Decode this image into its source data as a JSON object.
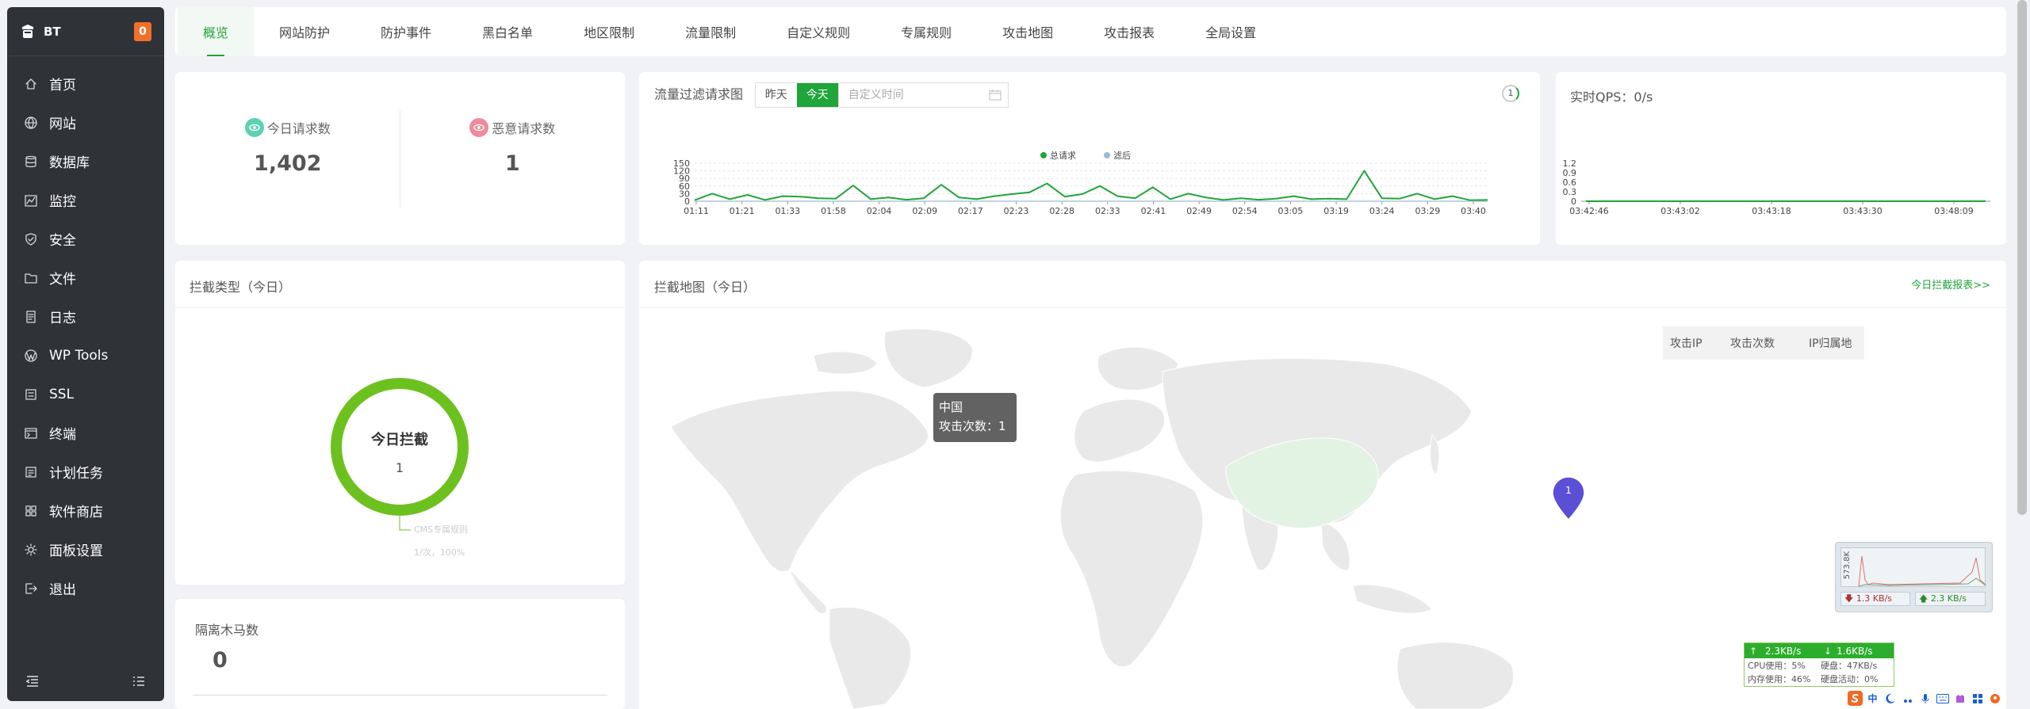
{
  "sidebar": {
    "brand": "BT",
    "badge": "0",
    "items": [
      {
        "label": "首页",
        "icon": "home-icon"
      },
      {
        "label": "网站",
        "icon": "globe-icon"
      },
      {
        "label": "数据库",
        "icon": "database-icon"
      },
      {
        "label": "监控",
        "icon": "monitor-icon"
      },
      {
        "label": "安全",
        "icon": "shield-icon"
      },
      {
        "label": "文件",
        "icon": "folder-icon"
      },
      {
        "label": "日志",
        "icon": "log-icon"
      },
      {
        "label": "WP Tools",
        "icon": "wordpress-icon"
      },
      {
        "label": "SSL",
        "icon": "ssl-icon"
      },
      {
        "label": "终端",
        "icon": "terminal-icon"
      },
      {
        "label": "计划任务",
        "icon": "task-icon"
      },
      {
        "label": "软件商店",
        "icon": "store-icon"
      },
      {
        "label": "面板设置",
        "icon": "gear-icon"
      },
      {
        "label": "退出",
        "icon": "logout-icon"
      }
    ]
  },
  "tabs": [
    "概览",
    "网站防护",
    "防护事件",
    "黑白名单",
    "地区限制",
    "流量限制",
    "自定义规则",
    "专属规则",
    "攻击地图",
    "攻击报表",
    "全局设置"
  ],
  "stats": {
    "today_label": "今日请求数",
    "today_value": "1,402",
    "malicious_label": "恶意请求数",
    "malicious_value": "1"
  },
  "traffic": {
    "title": "流量过滤请求图",
    "btn_yesterday": "昨天",
    "btn_today": "今天",
    "date_placeholder": "自定义时间",
    "refresh": "1"
  },
  "qps": {
    "title": "实时QPS：0/s"
  },
  "intercept_type": {
    "title": "拦截类型（今日）",
    "donut_title": "今日拦截",
    "donut_value": "1",
    "legend_name": "CMS专属规则",
    "legend_detail": "1/次，100%"
  },
  "trojan": {
    "title": "隔离木马数",
    "value": "0"
  },
  "attack_map": {
    "title": "拦截地图（今日）",
    "report_link": "今日拦截报表>>",
    "tooltip_country": "中国",
    "tooltip_count": "攻击次数：1",
    "marker_value": "1",
    "columns": [
      "攻击IP",
      "攻击次数",
      "IP归属地"
    ]
  },
  "netmon": {
    "peak": "573.8K",
    "down": "1.3 KB/s",
    "up": "2.3 KB/s"
  },
  "sysmon": {
    "up": "2.3KB/s",
    "down": "1.6KB/s",
    "cpu": "CPU使用：5%",
    "disk": "硬盘：47KB/s",
    "mem": "内存使用：46%",
    "disk_act": "硬盘活动：0%"
  },
  "tray": [
    "中"
  ],
  "colors": {
    "accent": "#20a53a",
    "sidebar": "#2f3237",
    "line": "#20a53a",
    "donut": "#6cc11f",
    "marker": "#5b4fd6"
  },
  "chart_data": [
    {
      "type": "line",
      "legend": [
        "总请求",
        "滤后"
      ],
      "legend_position": "top-center",
      "x": [
        "01:11",
        "01:21",
        "01:33",
        "01:58",
        "02:04",
        "02:09",
        "02:17",
        "02:23",
        "02:28",
        "02:33",
        "02:41",
        "02:49",
        "02:54",
        "03:05",
        "03:19",
        "03:24",
        "03:29",
        "03:40"
      ],
      "ylim": [
        0,
        150
      ],
      "yticks": [
        0,
        30,
        60,
        90,
        120,
        150
      ],
      "series": [
        {
          "name": "总请求",
          "values": [
            4,
            30,
            8,
            25,
            5,
            20,
            18,
            12,
            10,
            62,
            8,
            15,
            6,
            12,
            65,
            15,
            8,
            20,
            28,
            35,
            70,
            18,
            28,
            60,
            20,
            12,
            55,
            8,
            30,
            15,
            5,
            12,
            6,
            10,
            20,
            8,
            10,
            8,
            120,
            12,
            10,
            30,
            8,
            20,
            4,
            5
          ]
        },
        {
          "name": "滤后",
          "values": [
            0,
            0,
            0,
            0,
            0,
            0,
            0,
            0,
            0,
            0,
            0,
            0,
            0,
            0,
            0,
            0,
            0,
            0,
            0,
            0,
            0,
            0,
            0,
            0,
            0,
            0,
            0,
            0,
            0,
            0,
            0,
            0,
            0,
            0,
            0,
            0,
            0,
            0,
            0,
            0,
            0,
            0,
            0,
            0,
            0,
            0
          ]
        }
      ],
      "grid": true
    },
    {
      "type": "line",
      "x": [
        "03:42:46",
        "03:43:02",
        "03:43:18",
        "03:43:30",
        "03:48:09"
      ],
      "ylim": [
        0,
        1.2
      ],
      "yticks": [
        0,
        0.3,
        0.6,
        0.9,
        1.2
      ],
      "series": [
        {
          "values": [
            0,
            0,
            0,
            0,
            0
          ]
        }
      ],
      "grid": false
    },
    {
      "type": "pie",
      "categories": [
        "CMS专属规则"
      ],
      "values": [
        1
      ]
    }
  ]
}
